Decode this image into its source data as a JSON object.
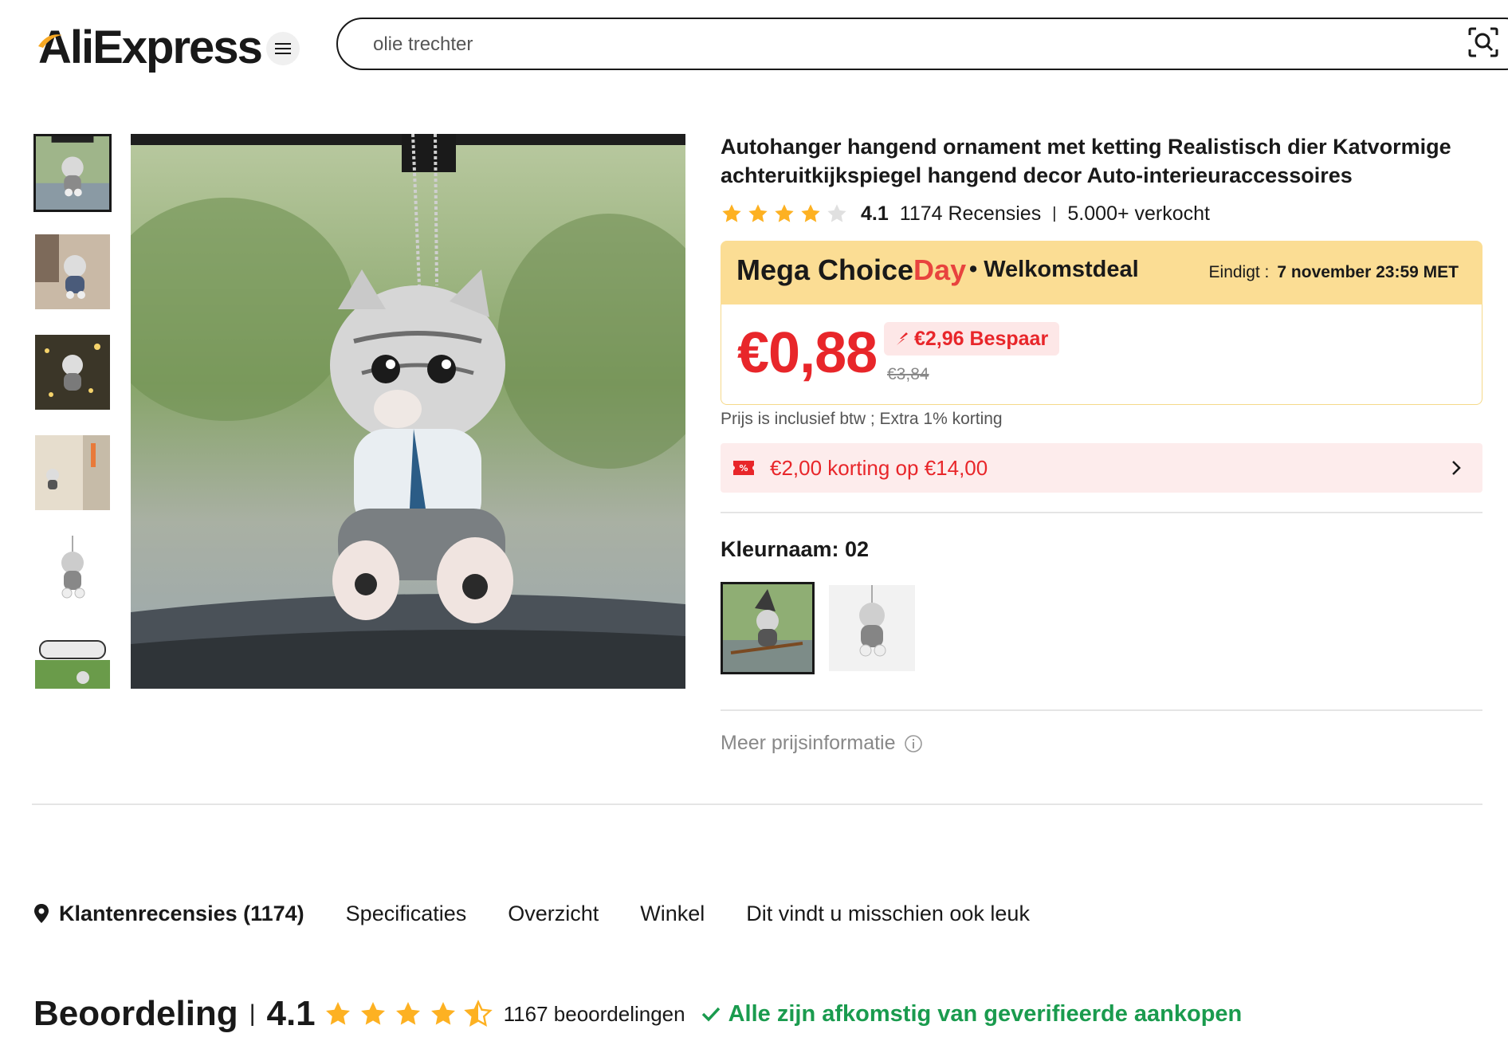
{
  "header": {
    "logo_text": "AliExpress",
    "search_value": "olie trechter",
    "search_placeholder": "olie trechter"
  },
  "product": {
    "title": "Autohanger hangend ornament met ketting Realistisch dier Katvormige achteruitkijkspiegel hangend decor Auto-interieuraccessoires",
    "rating": "4.1",
    "rating_value": 4.1,
    "reviews": "1174 Recensies",
    "sold": "5.000+ verkocht",
    "thumbnail_count": 6,
    "active_thumbnail": 1
  },
  "deal": {
    "title_part1": "Mega Choice",
    "title_part2": "Day",
    "subtitle": "• Welkomstdeal",
    "ends_label": "Eindigt :",
    "ends_value": "7 november 23:59 MET"
  },
  "price": {
    "current": "€0,88",
    "save": "€2,96 Bespaar",
    "original": "€3,84",
    "tax_note": "Prijs is inclusief btw ; Extra 1% korting"
  },
  "coupon": {
    "text": "€2,00 korting op €14,00"
  },
  "variants": {
    "label": "Kleurnaam: 02",
    "selected_index": 0
  },
  "more_price_info": "Meer prijsinformatie",
  "tabs": [
    {
      "label": "Klantenrecensies (1174)"
    },
    {
      "label": "Specificaties"
    },
    {
      "label": "Overzicht"
    },
    {
      "label": "Winkel"
    },
    {
      "label": "Dit vindt u misschien ook leuk"
    }
  ],
  "rating_summary": {
    "title": "Beoordeling",
    "separator": "|",
    "value": "4.1",
    "count": "1167 beoordelingen",
    "verified": "Alle zijn afkomstig van geverifieerde aankopen"
  },
  "colors": {
    "price_red": "#e8262a",
    "deal_yellow": "#fbdd94",
    "star_orange": "#fdb122",
    "verified_green": "#1a9b4e"
  }
}
